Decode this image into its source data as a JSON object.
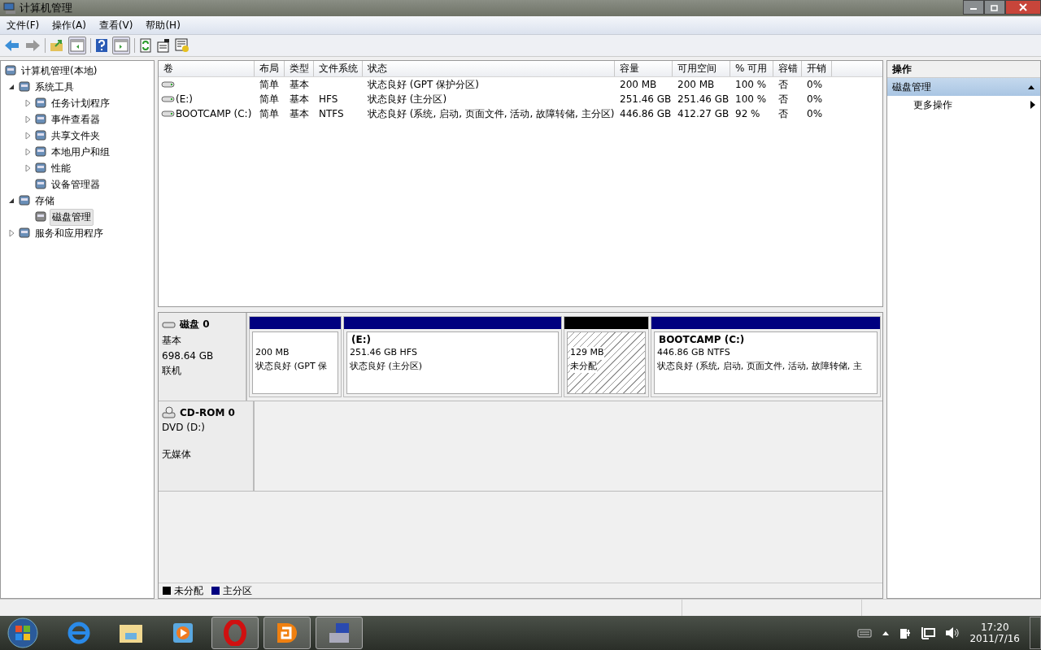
{
  "window": {
    "title": "计算机管理"
  },
  "menu": [
    {
      "label": "文件(F)"
    },
    {
      "label": "操作(A)"
    },
    {
      "label": "查看(V)"
    },
    {
      "label": "帮助(H)"
    }
  ],
  "tree": [
    {
      "label": "计算机管理(本地)",
      "selected": false,
      "children": [
        {
          "label": "系统工具",
          "selected": false,
          "expanded": true,
          "children": [
            {
              "label": "任务计划程序",
              "selected": false,
              "expanded": false
            },
            {
              "label": "事件查看器",
              "selected": false,
              "expanded": false
            },
            {
              "label": "共享文件夹",
              "selected": false,
              "expanded": false
            },
            {
              "label": "本地用户和组",
              "selected": false,
              "expanded": false
            },
            {
              "label": "性能",
              "selected": false,
              "expanded": false
            },
            {
              "label": "设备管理器",
              "selected": false
            }
          ]
        },
        {
          "label": "存储",
          "selected": false,
          "expanded": true,
          "children": [
            {
              "label": "磁盘管理",
              "selected": true
            }
          ]
        },
        {
          "label": "服务和应用程序",
          "selected": false,
          "expanded": false
        }
      ]
    }
  ],
  "table": {
    "columns": [
      "卷",
      "布局",
      "类型",
      "文件系统",
      "状态",
      "容量",
      "可用空间",
      "% 可用",
      "容错",
      "开销"
    ],
    "rows": [
      {
        "cells": [
          "",
          "简单",
          "基本",
          "",
          "状态良好 (GPT 保护分区)",
          "200 MB",
          "200 MB",
          "100 %",
          "否",
          "0%"
        ]
      },
      {
        "cells": [
          " (E:)",
          "简单",
          "基本",
          "HFS",
          "状态良好 (主分区)",
          "251.46 GB",
          "251.46 GB",
          "100 %",
          "否",
          "0%"
        ]
      },
      {
        "cells": [
          "BOOTCAMP (C:)",
          "简单",
          "基本",
          "NTFS",
          "状态良好 (系统, 启动, 页面文件, 活动, 故障转储, 主分区)",
          "446.86 GB",
          "412.27 GB",
          "92 %",
          "否",
          "0%"
        ]
      }
    ]
  },
  "disks": [
    {
      "kind": "disk",
      "name": "磁盘 0",
      "info": [
        "基本",
        "698.64 GB"
      ],
      "status": "联机",
      "partitions": [
        {
          "kind": "primary",
          "lines": [
            "200 MB",
            "状态良好 (GPT 保"
          ]
        },
        {
          "kind": "primary",
          "title": "(E:)",
          "lines": [
            "251.46 GB HFS",
            "状态良好 (主分区)"
          ]
        },
        {
          "kind": "unallocated",
          "lines": [
            "129 MB",
            "未分配"
          ]
        },
        {
          "kind": "primary",
          "title": "BOOTCAMP  (C:)",
          "lines": [
            "446.86 GB NTFS",
            "状态良好 (系统, 启动, 页面文件, 活动, 故障转储, 主"
          ]
        }
      ]
    },
    {
      "kind": "cdrom",
      "name": "CD-ROM 0",
      "info": [
        "DVD (D:)"
      ],
      "status": "无媒体"
    }
  ],
  "legend": [
    {
      "label": "未分配",
      "color": "#000000"
    },
    {
      "label": "主分区",
      "color": "#000080"
    }
  ],
  "actions": {
    "title": "操作",
    "section": {
      "label": "磁盘管理",
      "expanded": true
    },
    "items": [
      {
        "label": "更多操作"
      }
    ]
  },
  "taskbar": {
    "apps": [
      {
        "running": false
      },
      {
        "running": false
      },
      {
        "running": false
      },
      {
        "running": true
      },
      {
        "running": true
      },
      {
        "running": true
      }
    ],
    "time": "17:20",
    "date": "2011/7/16"
  }
}
